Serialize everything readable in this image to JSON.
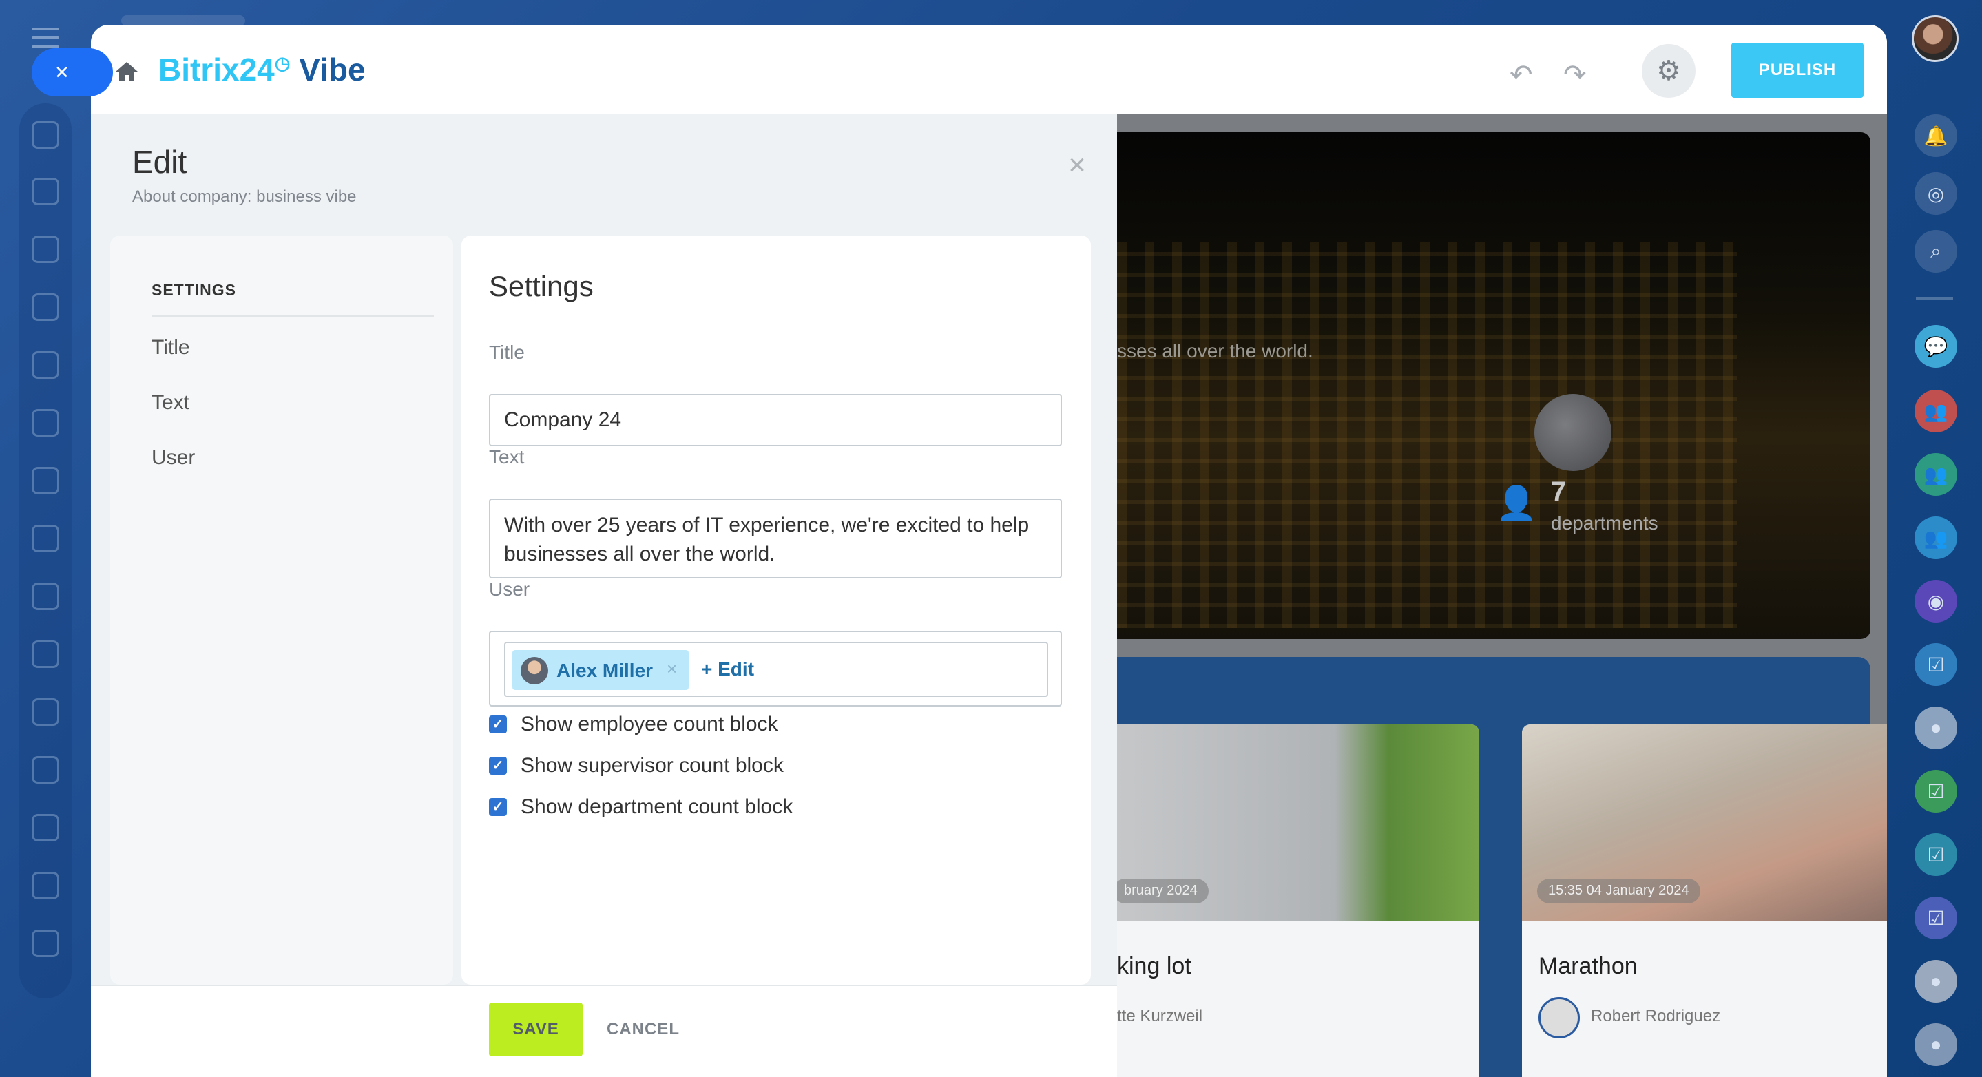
{
  "header": {
    "logo_main": "Bitrix24",
    "logo_clock": "◷",
    "logo_suffix": " Vibe",
    "publish_label": "PUBLISH"
  },
  "panel": {
    "title": "Edit",
    "subtitle": "About company: business vibe"
  },
  "settings_nav": {
    "heading": "SETTINGS",
    "items": [
      "Title",
      "Text",
      "User"
    ]
  },
  "form": {
    "heading": "Settings",
    "title_label": "Title",
    "title_value": "Company 24",
    "text_label": "Text",
    "text_value": "With over 25 years of IT experience, we're excited to help businesses all over the world.",
    "user_label": "User",
    "user_name": "Alex Miller",
    "user_remove": "×",
    "user_edit": "+ Edit",
    "checkboxes": [
      {
        "label": "Show employee count block",
        "checked": true
      },
      {
        "label": "Show supervisor count block",
        "checked": true
      },
      {
        "label": "Show department count block",
        "checked": true
      }
    ]
  },
  "footer": {
    "save_label": "SAVE",
    "cancel_label": "CANCEL"
  },
  "preview": {
    "hero_text": "sses all over the world.",
    "departments_count": "7",
    "departments_label": "departments",
    "cards": [
      {
        "date": "bruary 2024",
        "title": "king lot",
        "author": "tte Kurzweil"
      },
      {
        "date": "15:35 04 January 2024",
        "title": "Marathon",
        "author": "Robert Rodriguez"
      }
    ]
  },
  "colors": {
    "accent": "#2fc6f6",
    "publish": "#3bc8f5",
    "save": "#bbed21",
    "checkbox": "#2c73d2",
    "rail_close": "#1e6ef5"
  },
  "icons": {
    "rail_left": [
      "menu-icon",
      "close-icon",
      "feed-icon",
      "chat-icon",
      "tasks-icon",
      "hexagon-icon",
      "calendar-icon",
      "docs-icon",
      "board-icon",
      "drive-icon",
      "mail-icon",
      "groups-icon",
      "check-icon",
      "filter-icon",
      "grid-icon",
      "box-icon",
      "progress-icon"
    ],
    "rail_right": [
      "avatar",
      "bell-icon",
      "target-icon",
      "search-icon",
      "chat-bubble-icon",
      "group-icon",
      "group-icon",
      "group-icon",
      "target-icon",
      "task-icon",
      "avatar",
      "task-icon",
      "task-icon",
      "task-icon",
      "avatar",
      "avatar"
    ]
  }
}
